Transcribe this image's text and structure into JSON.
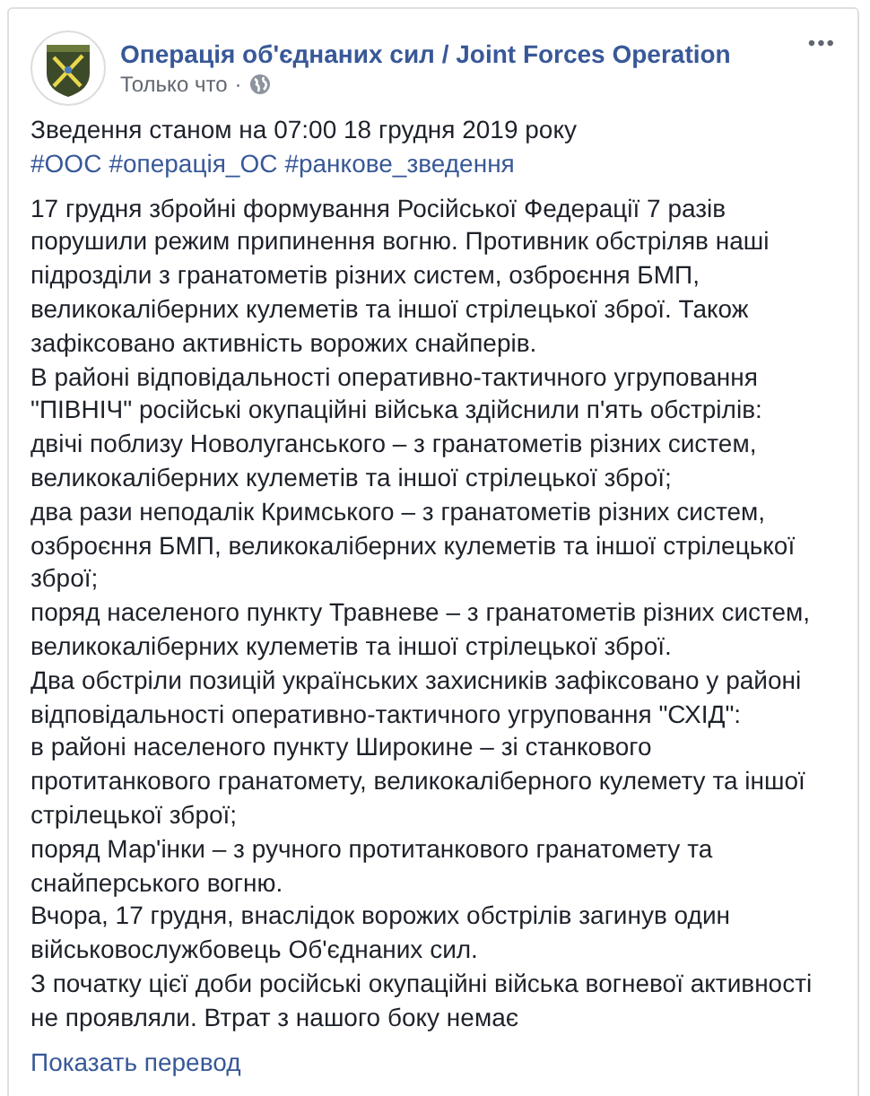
{
  "post": {
    "author": "Операція об'єднаних сил / Joint Forces Operation",
    "time": "Только что",
    "separator": "·",
    "more": "•••",
    "headline": "Зведення станом на 07:00 18 грудня 2019 року",
    "hashtags": [
      "#ООС",
      "#операція_ОС",
      "#ранкове_зведення"
    ],
    "paragraphs": [
      "17 грудня збройні формування Російської Федерації 7 разів порушили режим припинення вогню. Противник обстріляв наші підрозділи з гранатометів різних систем, озброєння БМП, великокаліберних кулеметів та іншої стрілецької зброї. Також зафіксовано активність ворожих снайперів.",
      "В районі відповідальності оперативно-тактичного угруповання \"ПІВНІЧ\" російські окупаційні війська здійснили п'ять обстрілів:",
      "двічі поблизу Новолуганського – з гранатометів різних систем, великокаліберних кулеметів та іншої стрілецької зброї;",
      "два рази неподалік Кримського – з гранатометів різних систем, озброєння БМП, великокаліберних кулеметів та іншої стрілецької зброї;",
      "поряд населеного пункту Травневе – з гранатометів різних систем, великокаліберних кулеметів та іншої стрілецької зброї.",
      "Два обстріли позицій українських захисників зафіксовано у районі відповідальності оперативно-тактичного угруповання \"СХІД\":",
      "в районі населеного пункту Широкине – зі станкового протитанкового гранатомету, великокаліберного кулемету та іншої стрілецької зброї;",
      "поряд Мар'інки – з ручного протитанкового гранатомету та снайперського вогню.",
      "Вчора, 17 грудня, внаслідок ворожих обстрілів загинув один військовослужбовець Об'єднаних сил.",
      "З початку цієї доби російські окупаційні війська вогневої активності не проявляли. Втрат з нашого боку немає"
    ],
    "translate": "Показать перевод"
  }
}
